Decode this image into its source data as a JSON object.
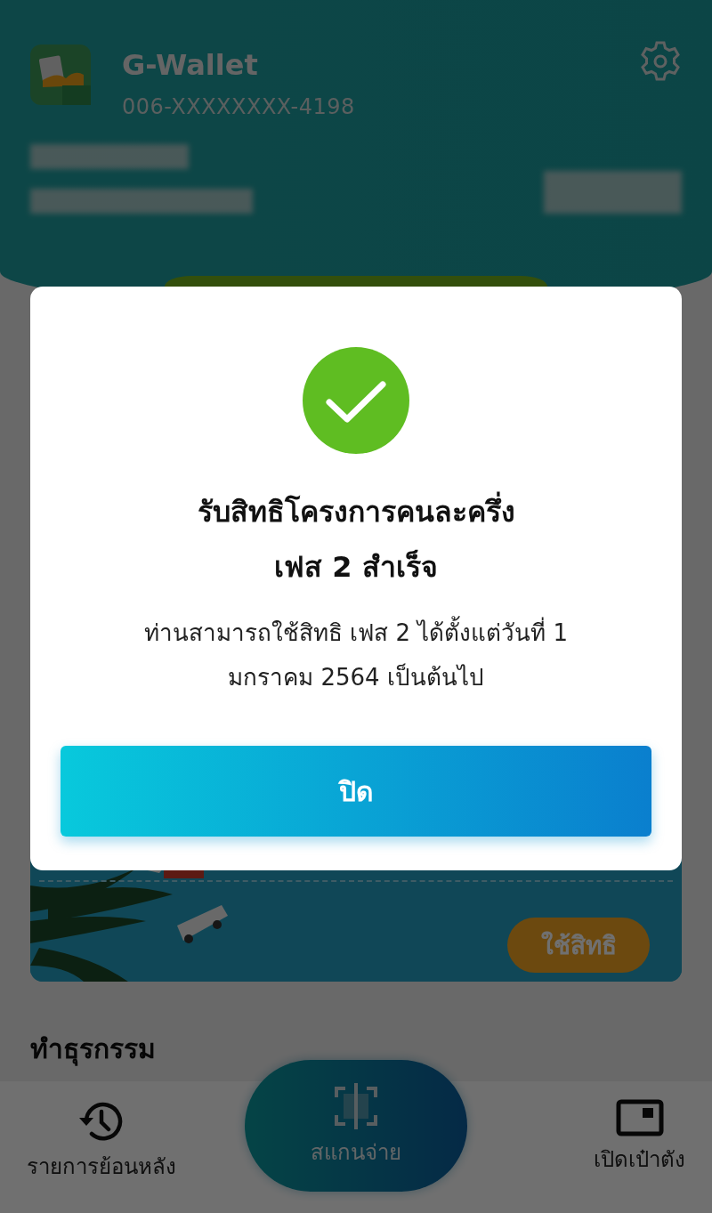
{
  "app": {
    "name": "G-Wallet",
    "account": "006-XXXXXXXX-4198"
  },
  "banner": {
    "button": "ใช้สิทธิ"
  },
  "section_title": "ทำธุรกรรม",
  "bottom_nav": [
    {
      "label": "รายการย้อนหลัง",
      "kind": "history"
    },
    {
      "label": "สแกนจ่าย",
      "kind": "scan"
    },
    {
      "label": "เปิดเป๋าตัง",
      "kind": "wallet"
    }
  ],
  "dialog": {
    "title": "รับสิทธิโครงการคนละครึ่ง\nเฟส 2 สำเร็จ",
    "message": "ท่านสามารถใช้สิทธิ เฟส 2 ได้ตั้งแต่วันที่ 1\nมกราคม 2564 เป็นต้นไป",
    "button": "ปิด"
  }
}
